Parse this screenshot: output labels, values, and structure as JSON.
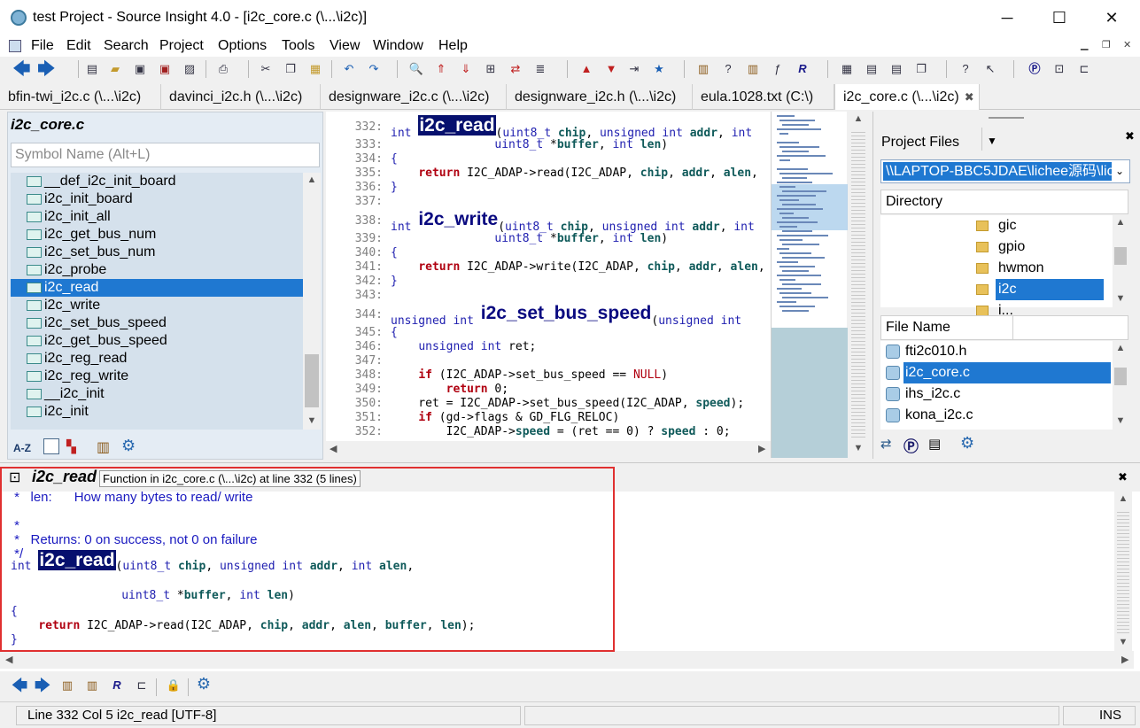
{
  "window": {
    "title": "test Project - Source Insight 4.0 - [i2c_core.c (\\...\\i2c)]",
    "minimize": "─",
    "maximize": "☐",
    "close": "✕"
  },
  "menu": [
    "File",
    "Edit",
    "Search",
    "Project",
    "Options",
    "Tools",
    "View",
    "Window",
    "Help"
  ],
  "tabs": [
    {
      "label": "bfin-twi_i2c.c (\\...\\i2c)"
    },
    {
      "label": "davinci_i2c.h (\\...\\i2c)"
    },
    {
      "label": "designware_i2c.c (\\...\\i2c)"
    },
    {
      "label": "designware_i2c.h (\\...\\i2c)"
    },
    {
      "label": "eula.1028.txt (C:\\)"
    },
    {
      "label": "i2c_core.c (\\...\\i2c)",
      "active": true
    }
  ],
  "symbol_panel": {
    "title": "i2c_core.c",
    "search_placeholder": "Symbol Name (Alt+L)",
    "items": [
      "__def_i2c_init_board",
      "i2c_init_board",
      "i2c_init_all",
      "i2c_get_bus_num",
      "i2c_set_bus_num",
      "i2c_probe",
      "i2c_read",
      "i2c_write",
      "i2c_set_bus_speed",
      "i2c_get_bus_speed",
      "i2c_reg_read",
      "i2c_reg_write",
      "__i2c_init",
      "i2c_init"
    ],
    "selected_index": 6,
    "sort_label": "A-Z"
  },
  "editor": {
    "lines": [
      {
        "n": "332:",
        "kind": "fn",
        "pre": "int ",
        "fn": "i2c_read",
        "sel": true,
        "post": "(uint8_t chip, unsigned int addr, int"
      },
      {
        "n": "333:",
        "text": "               uint8_t *buffer, int len)"
      },
      {
        "n": "334:",
        "text": "{"
      },
      {
        "n": "335:",
        "text": "    return I2C_ADAP->read(I2C_ADAP, chip, addr, alen,"
      },
      {
        "n": "336:",
        "text": "}"
      },
      {
        "n": "337:",
        "text": ""
      },
      {
        "n": "338:",
        "kind": "fn",
        "pre": "int ",
        "fn": "i2c_write",
        "post": "(uint8_t chip, unsigned int addr, int"
      },
      {
        "n": "339:",
        "text": "               uint8_t *buffer, int len)"
      },
      {
        "n": "340:",
        "text": "{"
      },
      {
        "n": "341:",
        "text": "    return I2C_ADAP->write(I2C_ADAP, chip, addr, alen,"
      },
      {
        "n": "342:",
        "text": "}"
      },
      {
        "n": "343:",
        "text": ""
      },
      {
        "n": "344:",
        "kind": "fn",
        "pre": "unsigned int ",
        "fn": "i2c_set_bus_speed",
        "post": "(unsigned int"
      },
      {
        "n": "345:",
        "text": "{"
      },
      {
        "n": "346:",
        "text": "    unsigned int ret;"
      },
      {
        "n": "347:",
        "text": ""
      },
      {
        "n": "348:",
        "text": "    if (I2C_ADAP->set_bus_speed == NULL)"
      },
      {
        "n": "349:",
        "text": "        return 0;"
      },
      {
        "n": "350:",
        "text": "    ret = I2C_ADAP->set_bus_speed(I2C_ADAP, speed);"
      },
      {
        "n": "351:",
        "text": "    if (gd->flags & GD_FLG_RELOC)"
      },
      {
        "n": "352:",
        "text": "        I2C_ADAP->speed = (ret == 0) ? speed : 0;"
      }
    ]
  },
  "project_panel": {
    "title": "Project Files",
    "path": "\\\\LAPTOP-BBC5JDAE\\lichee源码\\lic",
    "directory_header": "Directory",
    "directories": [
      "gic",
      "gpio",
      "hwmon",
      "i2c",
      "i..."
    ],
    "selected_dir": "i2c",
    "filename_header": "File Name",
    "files": [
      "fti2c010.h",
      "i2c_core.c",
      "ihs_i2c.c",
      "kona_i2c.c"
    ],
    "selected_file": "i2c_core.c"
  },
  "context": {
    "symbol": "i2c_read",
    "info": "Function in i2c_core.c (\\...\\i2c) at line 332 (5 lines)",
    "comment_lines": [
      " *   len:      How many bytes to read/ write",
      " *",
      " *   Returns: 0 on success, not 0 on failure",
      " */"
    ],
    "sig_pre": "int ",
    "sig_fn": "i2c_read",
    "sig_post": "(uint8_t chip, unsigned int addr, int alen,",
    "sig_line2": "                uint8_t *buffer, int len)",
    "body_open": "{",
    "body": "    return I2C_ADAP->read(I2C_ADAP, chip, addr, alen, buffer, len);",
    "body_close": "}"
  },
  "status": {
    "position": "Line 332  Col 5   i2c_read [UTF-8]",
    "mode": "INS"
  },
  "colors": {
    "selection": "#1f78d1",
    "symbol_highlight": "#06106e",
    "annotation_box": "#e03030"
  }
}
